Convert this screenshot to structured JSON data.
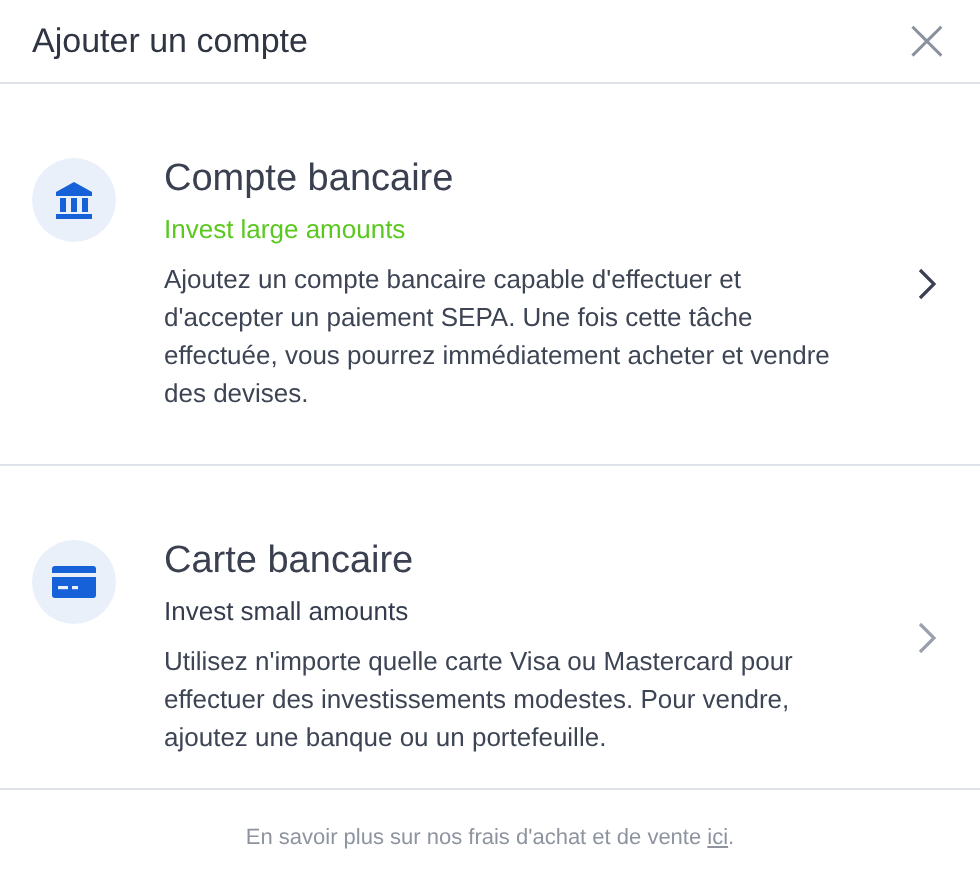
{
  "dialog": {
    "title": "Ajouter un compte",
    "close": "×"
  },
  "options": [
    {
      "kind": "bank",
      "selected": true,
      "title": "Compte bancaire",
      "subtitle": "Invest large amounts",
      "description": "Ajoutez un compte bancaire capable d'effectuer et d'accepter un paiement SEPA. Une fois cette tâche effectuée, vous pourrez immédiatement acheter et vendre des devises."
    },
    {
      "kind": "card",
      "selected": false,
      "title": "Carte bancaire",
      "subtitle": "Invest small amounts",
      "description": "Utilisez n'importe quelle carte Visa ou Mastercard pour effectuer des investissements modestes. Pour vendre, ajoutez une banque ou un portefeuille."
    }
  ],
  "footer": {
    "text": "En savoir plus sur nos frais d'achat et de vente ",
    "link": "ici",
    "end": "."
  }
}
